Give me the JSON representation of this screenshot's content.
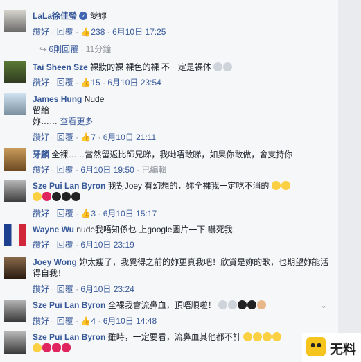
{
  "comments": [
    {
      "name": "LaLa徐佳瑩",
      "text": "愛妳",
      "likes": "238",
      "time": "6月10日 17:25",
      "replies": "6則回覆",
      "replies_time": "11分鐘"
    },
    {
      "name": "Tai Sheen Sze",
      "text": "裸妝的裸 裸色的裸 不一定是裸体",
      "likes": "15",
      "time": "6月10日 23:54"
    },
    {
      "name": "James Hung",
      "text": "Nude",
      "line2": "留給",
      "line3": "妳……",
      "see_more": "查看更多",
      "likes": "7",
      "time": "6月10日 21:11"
    },
    {
      "name": "牙麟",
      "text": "全裸……當然留返比師兄睇，我哋唔敢睇，如果你敢做，會支持你",
      "time": "6月10日 19:50",
      "edited": "已編輯"
    },
    {
      "name": "Sze Pui Lan Byron",
      "text": "我對Joey 有幻想的，妳全裸我一定吃不消的",
      "likes": "3",
      "time": "6月10日 15:17"
    },
    {
      "name": "Wayne Wu",
      "text": "nude我唔知係乜 上google圖片一下 嚇死我",
      "time": "6月10日 23:19"
    },
    {
      "name": "Joey Wong",
      "text": "妳太瘦了，我覺得之前的妳更真我吧！欣賞是妳的歌，也期望妳能活得自我！",
      "time": "6月10日 23:24"
    },
    {
      "name": "Sze Pui Lan Byron",
      "text": "全裸我會流鼻血，頂唔順啦！",
      "likes": "4",
      "time": "6月10日 14:48"
    },
    {
      "name": "Sze Pui Lan Byron",
      "text": "雖時，一定要看，流鼻血其他都不計"
    }
  ],
  "actions": {
    "like": "讚好",
    "reply": "回覆",
    "sep": "·"
  },
  "watermark": "无料"
}
